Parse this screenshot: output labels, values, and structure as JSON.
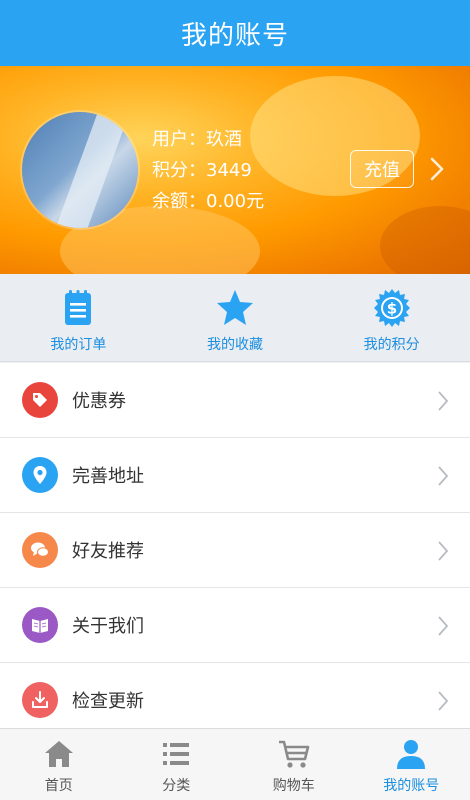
{
  "header": {
    "title": "我的账号"
  },
  "profile": {
    "user_label": "用户：",
    "user_name": "玖酒",
    "points_label": "积分：",
    "points_value": "3449",
    "balance_label": "余额：",
    "balance_value": "0.00元",
    "recharge_label": "充值"
  },
  "quick": [
    {
      "label": "我的订单",
      "icon": "orders-icon"
    },
    {
      "label": "我的收藏",
      "icon": "star-icon"
    },
    {
      "label": "我的积分",
      "icon": "coin-icon"
    }
  ],
  "menu": [
    {
      "label": "优惠券",
      "icon": "coupon-tag-icon",
      "color": "#e8453c"
    },
    {
      "label": "完善地址",
      "icon": "location-pin-icon",
      "color": "#2aa3f3"
    },
    {
      "label": "好友推荐",
      "icon": "chat-bubbles-icon",
      "color": "#f5884a"
    },
    {
      "label": "关于我们",
      "icon": "book-icon",
      "color": "#9b59c6"
    },
    {
      "label": "检查更新",
      "icon": "download-icon",
      "color": "#f06262"
    }
  ],
  "tabs": [
    {
      "label": "首页",
      "icon": "home-icon",
      "active": false
    },
    {
      "label": "分类",
      "icon": "list-icon",
      "active": false
    },
    {
      "label": "购物车",
      "icon": "cart-icon",
      "active": false
    },
    {
      "label": "我的账号",
      "icon": "person-icon",
      "active": true
    }
  ],
  "colors": {
    "primary": "#2aa3f3",
    "accent_blue": "#1a8ee0",
    "tab_inactive": "#888888"
  }
}
